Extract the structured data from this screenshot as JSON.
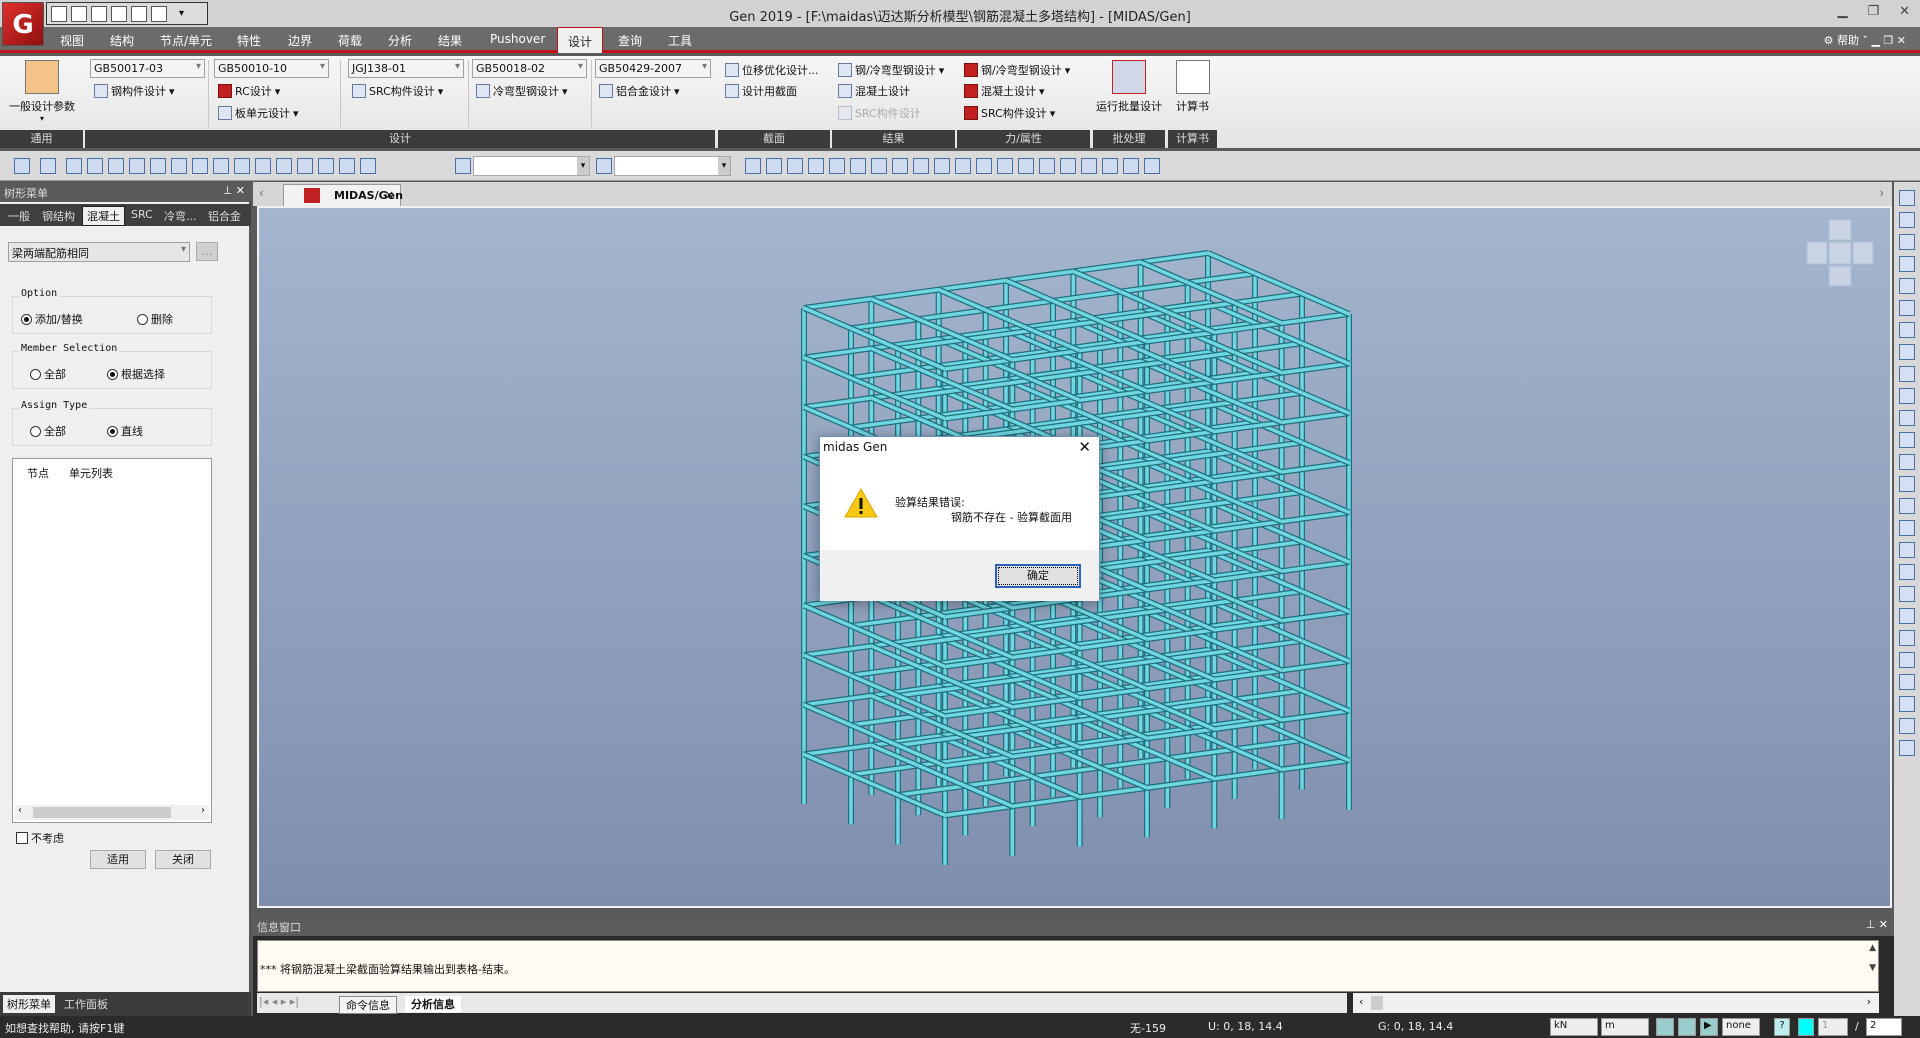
{
  "window": {
    "title": "Gen 2019 - [F:\\maidas\\迈达斯分析模型\\钢筋混凝土多塔结构] - [MIDAS/Gen]",
    "logo_text": "G",
    "controls": [
      "minimize",
      "restore",
      "close"
    ]
  },
  "menu": {
    "tabs": [
      "视图",
      "结构",
      "节点/单元",
      "特性",
      "边界",
      "荷载",
      "分析",
      "结果",
      "Pushover",
      "设计",
      "查询",
      "工具"
    ],
    "active": "设计",
    "help": "帮助"
  },
  "ribbon": {
    "general": {
      "label": "一般设计参数",
      "group": "通用"
    },
    "design": {
      "group": "设计",
      "columns": [
        {
          "code": "GB50017-03",
          "items": [
            "钢构件设计"
          ]
        },
        {
          "code": "GB50010-10",
          "items": [
            "RC设计",
            "板单元设计"
          ]
        },
        {
          "code": "JGJ138-01",
          "items": [
            "SRC构件设计"
          ]
        },
        {
          "code": "GB50018-02",
          "items": [
            "冷弯型钢设计"
          ]
        },
        {
          "code": "GB50429-2007",
          "items": [
            "铝合金设计"
          ]
        }
      ]
    },
    "section": {
      "group": "截面",
      "items": [
        "位移优化设计...",
        "设计用截面"
      ]
    },
    "results": {
      "group": "结果",
      "items": [
        "钢/冷弯型钢设计",
        "混凝土设计",
        "SRC构件设计"
      ]
    },
    "force": {
      "group": "力/属性",
      "items": [
        "钢/冷弯型钢设计",
        "混凝土设计",
        "SRC构件设计"
      ]
    },
    "batch": {
      "group": "批处理",
      "label": "运行批量设计"
    },
    "calc": {
      "group": "计算书",
      "label": "计算书"
    }
  },
  "left_panel": {
    "title": "树形菜单",
    "tabs": [
      "一般",
      "钢结构",
      "混凝土",
      "SRC",
      "冷弯...",
      "铝合金"
    ],
    "active_tab": "混凝土",
    "dropdown": "梁两端配筋相同",
    "option": {
      "legend": "Option",
      "choices": [
        "添加/替换",
        "删除"
      ],
      "selected": "添加/替换"
    },
    "member_selection": {
      "legend": "Member Selection",
      "choices": [
        "全部",
        "根据选择"
      ],
      "selected": "根据选择"
    },
    "assign_type": {
      "legend": "Assign Type",
      "choices": [
        "全部",
        "直线"
      ],
      "selected": "直线"
    },
    "list_headers": [
      "节点",
      "单元列表"
    ],
    "checkbox": {
      "label": "不考虑",
      "checked": false
    },
    "apply": "适用",
    "close": "关闭",
    "bottom_tabs": [
      "树形菜单",
      "工作面板"
    ]
  },
  "document_tab": "MIDAS/Gen",
  "dialog": {
    "title": "midas Gen",
    "line1": "验算结果错误:",
    "line2": "钢筋不存在 - 验算截面用",
    "ok": "确定",
    "icon": "warning-icon"
  },
  "info_window": {
    "title": "信息窗口",
    "message": "*** 将钢筋混凝土梁截面验算结果输出到表格-结束。",
    "tabs": [
      "命令信息",
      "分析信息"
    ],
    "active_tab": "分析信息"
  },
  "status": {
    "help": "如想查找帮助, 请按F1键",
    "selection": "无-159",
    "ucs": "U: 0, 18, 14.4",
    "gcs": "G: 0, 18, 14.4",
    "force_unit": "kN",
    "length_unit": "m",
    "none_select": "none",
    "page_current": "1",
    "page_sep": "/",
    "page_total": "2"
  },
  "colors": {
    "accent": "#c1121b",
    "model": "#6fd6e2",
    "viewport_top": "#a4b5ce",
    "viewport_bottom": "#7f8ead"
  },
  "toolbar_icons": [
    "undo",
    "redo",
    "select-node",
    "select-tree",
    "select-single",
    "select-window",
    "select-polygon",
    "select-intersect",
    "select-plane",
    "select-volume",
    "select-property",
    "select-previous",
    "select-identity",
    "unselect-single",
    "unselect-window",
    "unselect-intersect",
    "unselect-all",
    "select-entity",
    "select-line"
  ],
  "right_toolbar_icons": [
    "grid",
    "grid-snap",
    "node-snap",
    "line-grid",
    "point-grid",
    "display",
    "hidden",
    "shrink",
    "element-display",
    "zoom-fit",
    "zoom-window",
    "zoom-in",
    "zoom-out",
    "zoom-all",
    "rotate",
    "pan",
    "dynamic",
    "view-top",
    "view-front",
    "view-left",
    "view-right",
    "view-iso",
    "view-iso2",
    "view-iso3",
    "view-iso4",
    "view-options"
  ]
}
